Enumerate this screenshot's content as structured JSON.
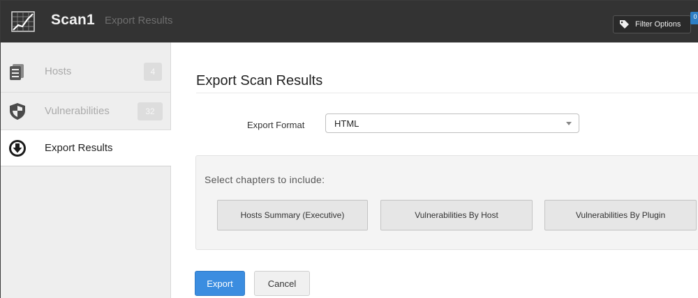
{
  "header": {
    "app_name": "Scan1",
    "section": "Export Results",
    "filter_label": "Filter Options",
    "filter_count": "0"
  },
  "sidebar": {
    "items": [
      {
        "label": "Hosts",
        "count": "4",
        "icon": "servers-icon",
        "active": false
      },
      {
        "label": "Vulnerabilities",
        "count": "32",
        "icon": "shield-icon",
        "active": false
      },
      {
        "label": "Export Results",
        "icon": "download-circle-icon",
        "active": true
      }
    ]
  },
  "main": {
    "title": "Export Scan Results",
    "format_label": "Export Format",
    "format_value": "HTML",
    "chapters_label": "Select chapters to include:",
    "chapters": [
      "Hosts Summary (Executive)",
      "Vulnerabilities By Host",
      "Vulnerabilities By Plugin"
    ],
    "export_label": "Export",
    "cancel_label": "Cancel"
  },
  "colors": {
    "topbar": "#333333",
    "accent": "#3b8de0",
    "sidebar_bg": "#eeeeee"
  }
}
